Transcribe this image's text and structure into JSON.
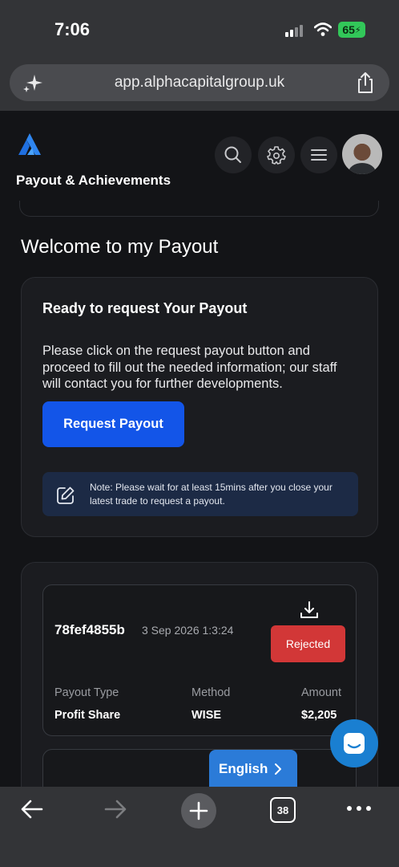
{
  "status_bar": {
    "time": "7:06",
    "battery": "65"
  },
  "browser": {
    "url": "app.alphacapitalgroup.uk",
    "tab_count": "38"
  },
  "header": {
    "title": "Payout & Achievements"
  },
  "welcome": "Welcome to my Payout",
  "request_card": {
    "title": "Ready to request Your Payout",
    "description": "Please click on the request payout button and proceed to fill out the needed information; our staff will contact you for further developments.",
    "button_label": "Request Payout",
    "note": "Note: Please wait for at least 15mins after you close your latest trade to request a payout."
  },
  "payouts": [
    {
      "id": "78fef4855b",
      "date": "3 Sep 2026 1:3:24",
      "status": "Rejected",
      "labels": {
        "type": "Payout Type",
        "method": "Method",
        "amount": "Amount"
      },
      "type": "Profit Share",
      "method": "WISE",
      "amount": "$2,205"
    }
  ],
  "language_button": "English",
  "colors": {
    "accent": "#1355e8",
    "rejected": "#d23737",
    "note_bg": "#1c2a45",
    "language": "#2b7bd8",
    "chat": "#1a7fd1"
  },
  "icons": [
    "sparkle-icon",
    "share-icon",
    "logo-icon",
    "search-icon",
    "gear-icon",
    "menu-icon",
    "edit-icon",
    "download-icon",
    "chevron-right-icon",
    "chat-icon",
    "back-icon",
    "forward-icon",
    "new-tab-icon",
    "tabs-icon",
    "more-icon"
  ]
}
